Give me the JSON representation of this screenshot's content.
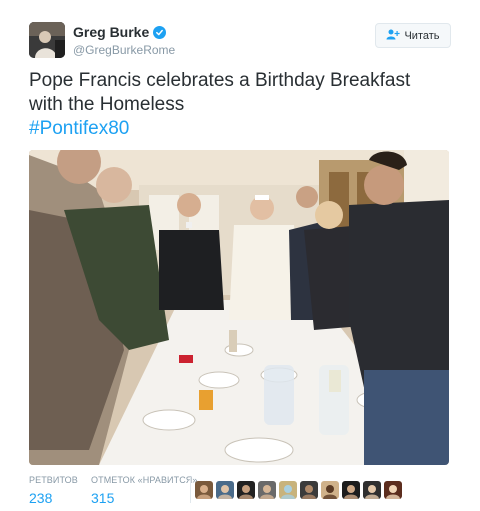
{
  "user": {
    "display_name": "Greg Burke",
    "screen_name": "@GregBurkeRome",
    "verified": true,
    "avatar_icon": "profile-photo"
  },
  "follow_button": {
    "label": "Читать",
    "icon": "add-person-icon"
  },
  "tweet": {
    "text": "Pope Francis celebrates a Birthday Breakfast with the Homeless",
    "hashtag": "#Pontifex80"
  },
  "stats": {
    "retweets_label": "РЕТВИТОВ",
    "retweets_count": "238",
    "likes_label": "ОТМЕТОК «НРАВИТСЯ»",
    "likes_count": "315"
  },
  "likers": [
    "liker-1",
    "liker-2",
    "liker-3",
    "liker-4",
    "liker-5",
    "liker-6",
    "liker-7",
    "liker-8",
    "liker-9",
    "liker-10"
  ],
  "colors": {
    "link": "#1da1f2",
    "text": "#292f33",
    "muted": "#8899a6",
    "border": "#e1e8ed"
  }
}
